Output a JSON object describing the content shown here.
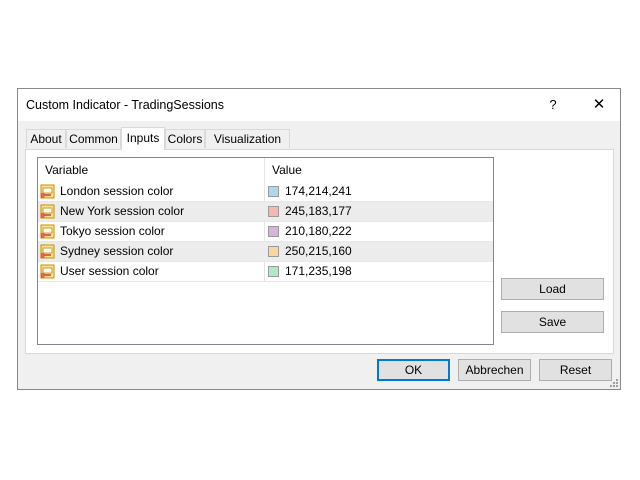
{
  "window": {
    "title": "Custom Indicator - TradingSessions",
    "help_glyph": "?",
    "close_glyph": "✕"
  },
  "tabs": [
    {
      "label": "About"
    },
    {
      "label": "Common"
    },
    {
      "label": "Inputs",
      "active": true
    },
    {
      "label": "Colors"
    },
    {
      "label": "Visualization"
    }
  ],
  "table": {
    "headers": {
      "variable": "Variable",
      "value": "Value"
    },
    "rows": [
      {
        "variable": "London session color",
        "value": "174,214,241",
        "swatch": "#aed6f1"
      },
      {
        "variable": "New York session color",
        "value": "245,183,177",
        "swatch": "#f5b7b1"
      },
      {
        "variable": "Tokyo session color",
        "value": "210,180,222",
        "swatch": "#d2b4de"
      },
      {
        "variable": "Sydney session color",
        "value": "250,215,160",
        "swatch": "#fad7a0"
      },
      {
        "variable": "User session color",
        "value": "171,235,198",
        "swatch": "#abebc6"
      }
    ]
  },
  "side_buttons": {
    "load": "Load",
    "save": "Save"
  },
  "footer_buttons": {
    "ok": "OK",
    "cancel": "Abbrechen",
    "reset": "Reset"
  },
  "colors": {
    "accent": "#0078d7",
    "dialog_bg": "#f0f0f0",
    "row_alt": "#ececec"
  }
}
